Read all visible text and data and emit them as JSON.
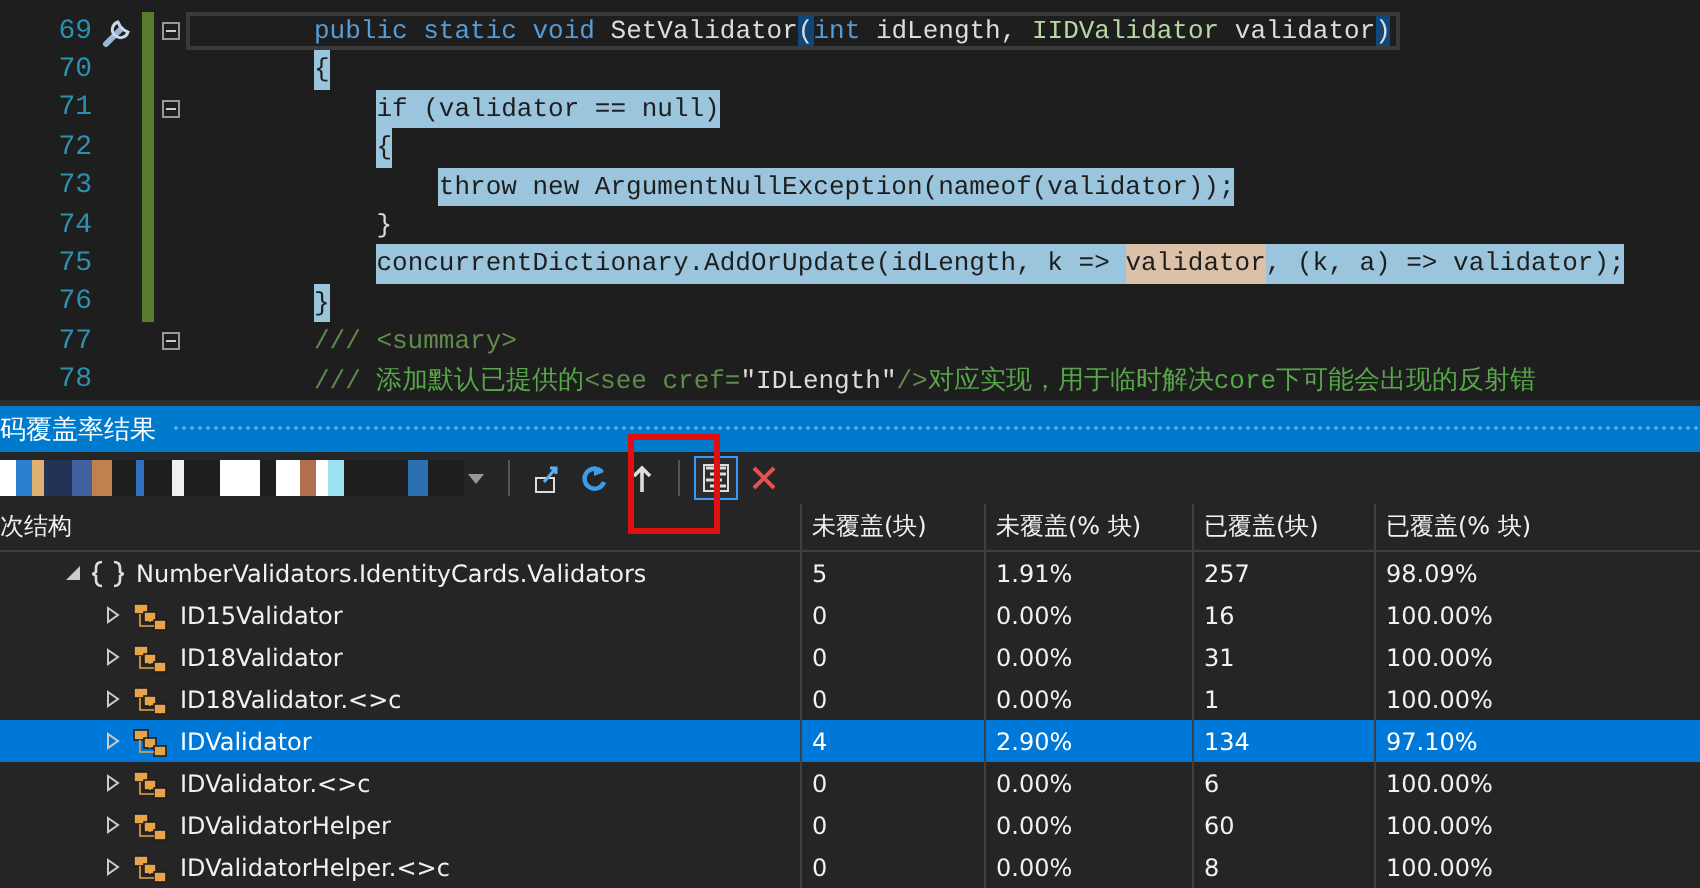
{
  "editor": {
    "lines": [
      {
        "number": "69",
        "action_icon": true,
        "changed": true,
        "foldable": true,
        "current": true,
        "tokens": [
          {
            "text": "public",
            "kind": "keyword",
            "selected": false
          },
          {
            "text": "static",
            "kind": "keyword",
            "selected": false
          },
          {
            "text": "void",
            "kind": "keyword",
            "selected": false
          },
          {
            "text": "SetValidator",
            "kind": "plain",
            "selected": false
          },
          {
            "text": "(",
            "kind": "plain",
            "selected": false,
            "brace_match": true
          },
          {
            "text": "int",
            "kind": "keyword",
            "selected": false
          },
          {
            "text": "idLength,",
            "kind": "plain",
            "selected": false
          },
          {
            "text": "IIDValidator",
            "kind": "interface",
            "selected": false
          },
          {
            "text": "validator",
            "kind": "plain",
            "selected": false
          },
          {
            "text": ")",
            "kind": "plain",
            "selected": false,
            "brace_match": true
          }
        ]
      },
      {
        "number": "70",
        "action_icon": false,
        "changed": true,
        "foldable": false,
        "current": false,
        "tokens": [
          {
            "text": "{",
            "kind": "plain",
            "selected": true
          }
        ]
      },
      {
        "number": "71",
        "action_icon": false,
        "changed": true,
        "foldable": true,
        "current": false,
        "tokens": [
          {
            "text": "    if (validator == null)",
            "kind": "plain",
            "selected": true
          }
        ]
      },
      {
        "number": "72",
        "action_icon": false,
        "changed": true,
        "foldable": false,
        "current": false,
        "tokens": [
          {
            "text": "    {",
            "kind": "plain",
            "selected": true
          }
        ]
      },
      {
        "number": "73",
        "action_icon": false,
        "changed": true,
        "foldable": false,
        "current": false,
        "tokens": [
          {
            "text": "        throw new ArgumentNullException(nameof(validator));",
            "kind": "plain",
            "selected": true
          }
        ]
      },
      {
        "number": "74",
        "action_icon": false,
        "changed": true,
        "foldable": false,
        "current": false,
        "tokens": [
          {
            "text": "    }",
            "kind": "plain",
            "selected": false
          }
        ]
      },
      {
        "number": "75",
        "action_icon": false,
        "changed": true,
        "foldable": false,
        "current": false,
        "tokens": [
          {
            "text": "    concurrentDictionary.AddOrUpdate(idLength, k => ",
            "kind": "plain",
            "selected": true
          },
          {
            "text": "validator",
            "kind": "plain",
            "selected": true,
            "reference": true
          },
          {
            "text": ", (k, a) => validator);",
            "kind": "plain",
            "selected": true
          }
        ]
      },
      {
        "number": "76",
        "action_icon": false,
        "changed": true,
        "foldable": false,
        "current": false,
        "tokens": [
          {
            "text": "}",
            "kind": "plain",
            "selected": true
          }
        ]
      },
      {
        "number": "77",
        "action_icon": false,
        "changed": false,
        "foldable": true,
        "current": false,
        "tokens": [
          {
            "text": "/// <summary>",
            "kind": "doc",
            "selected": false
          }
        ]
      },
      {
        "number": "78",
        "action_icon": false,
        "changed": false,
        "foldable": false,
        "current": false,
        "tokens": [
          {
            "text": "/// ",
            "kind": "doc",
            "selected": false
          },
          {
            "text": "添加默认已提供的",
            "kind": "comment",
            "selected": false
          },
          {
            "text": "<see cref=",
            "kind": "doc",
            "selected": false
          },
          {
            "text": "\"IDLength\"",
            "kind": "plain",
            "selected": false
          },
          {
            "text": "/>",
            "kind": "doc",
            "selected": false
          },
          {
            "text": "对应实现，用于临时解决core下可能会出现的反射错",
            "kind": "comment",
            "selected": false
          }
        ]
      }
    ]
  },
  "coverage_panel": {
    "title": "码覆盖率结果",
    "toolbar": [
      {
        "kind": "export",
        "selected": false
      },
      {
        "kind": "refresh",
        "selected": false
      },
      {
        "kind": "up",
        "selected": false
      },
      {
        "kind": "coloring",
        "selected": true
      },
      {
        "kind": "remove",
        "selected": false
      }
    ],
    "columns": [
      "次结构",
      "未覆盖(块)",
      "未覆盖(% 块)",
      "已覆盖(块)",
      "已覆盖(% 块)"
    ],
    "tree": [
      {
        "kind": "namespace",
        "name": "NumberValidators.IdentityCards.Validators",
        "expanded": true,
        "selected": false,
        "cells": [
          "5",
          "1.91%",
          "257",
          "98.09%"
        ],
        "children": [
          {
            "kind": "class",
            "name": "ID15Validator",
            "expanded": false,
            "selected": false,
            "cells": [
              "0",
              "0.00%",
              "16",
              "100.00%"
            ]
          },
          {
            "kind": "class",
            "name": "ID18Validator",
            "expanded": false,
            "selected": false,
            "cells": [
              "0",
              "0.00%",
              "31",
              "100.00%"
            ]
          },
          {
            "kind": "class",
            "name": "ID18Validator.<>c",
            "expanded": false,
            "selected": false,
            "cells": [
              "0",
              "0.00%",
              "1",
              "100.00%"
            ]
          },
          {
            "kind": "class",
            "name": "IDValidator",
            "expanded": false,
            "selected": true,
            "cells": [
              "4",
              "2.90%",
              "134",
              "97.10%"
            ]
          },
          {
            "kind": "class",
            "name": "IDValidator.<>c",
            "expanded": false,
            "selected": false,
            "cells": [
              "0",
              "0.00%",
              "6",
              "100.00%"
            ]
          },
          {
            "kind": "class",
            "name": "IDValidatorHelper",
            "expanded": false,
            "selected": false,
            "cells": [
              "0",
              "0.00%",
              "60",
              "100.00%"
            ]
          },
          {
            "kind": "class",
            "name": "IDValidatorHelper.<>c",
            "expanded": false,
            "selected": false,
            "cells": [
              "0",
              "0.00%",
              "8",
              "100.00%"
            ]
          }
        ]
      }
    ]
  }
}
